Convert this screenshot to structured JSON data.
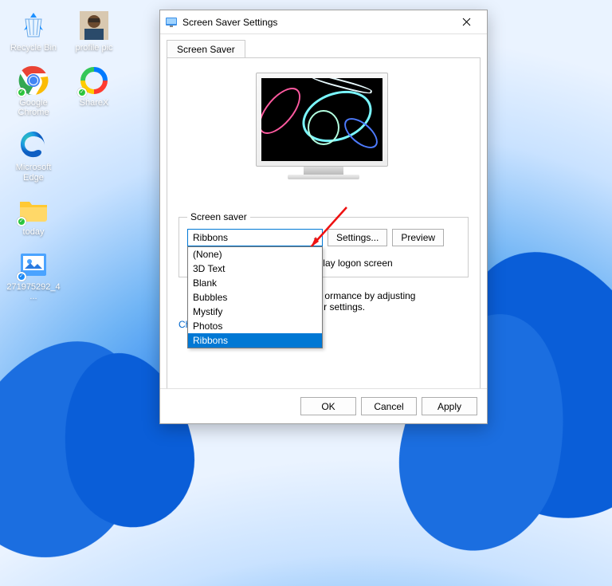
{
  "desktop": {
    "icons": [
      {
        "name": "recycle-bin",
        "label": "Recycle Bin"
      },
      {
        "name": "profile-pic",
        "label": "profile pic"
      },
      {
        "name": "google-chrome",
        "label": "Google Chrome"
      },
      {
        "name": "sharex",
        "label": "ShareX"
      },
      {
        "name": "microsoft-edge",
        "label": "Microsoft Edge"
      },
      {
        "name": "today-folder",
        "label": "today"
      },
      {
        "name": "image-file",
        "label": "271975292_4..."
      }
    ]
  },
  "dialog": {
    "title": "Screen Saver Settings",
    "tab": "Screen Saver",
    "group_label": "Screen saver",
    "selected": "Ribbons",
    "options": [
      "(None)",
      "3D Text",
      "Blank",
      "Bubbles",
      "Mystify",
      "Photos",
      "Ribbons"
    ],
    "settings_btn": "Settings...",
    "preview_btn": "Preview",
    "wait_suffix": "ume, display logon screen",
    "power_line1": "ormance by adjusting",
    "power_line2": "r settings.",
    "power_link": "Change power settings",
    "ok": "OK",
    "cancel": "Cancel",
    "apply": "Apply"
  }
}
